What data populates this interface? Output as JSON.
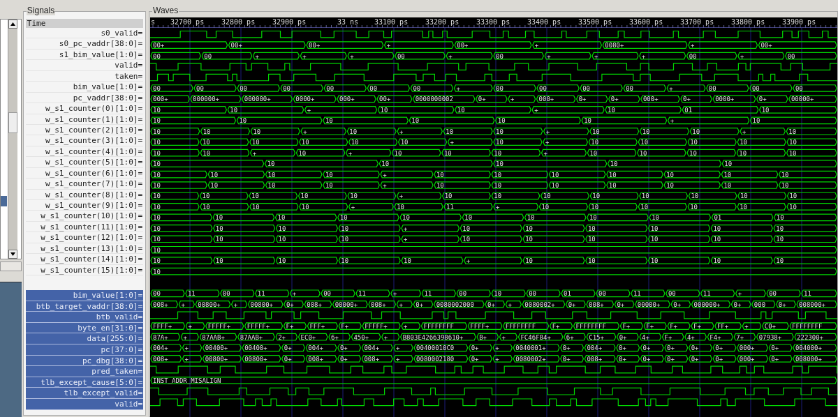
{
  "signals_panel": {
    "title": "Signals",
    "header": "Time"
  },
  "waves_panel": {
    "title": "Waves",
    "time_labels": [
      "s",
      "32700 ps",
      "32800 ps",
      "32900 ps",
      "33 ns",
      "33100 ps",
      "33200 ps",
      "33300 ps",
      "33400 ps",
      "33500 ps",
      "33600 ps",
      "33700 ps",
      "33800 ps",
      "33900 ps"
    ]
  },
  "signals": [
    {
      "name": "s0_valid=",
      "kind": "bit"
    },
    {
      "name": "s0_pc_vaddr[38:0]=",
      "kind": "bus",
      "values": [
        "00+",
        "00+",
        "00+",
        "+",
        "00+",
        "+",
        "0080+",
        "+",
        "00+"
      ]
    },
    {
      "name": "s1_bim_value[1:0]=",
      "kind": "bus",
      "values": [
        "00",
        "00",
        "+",
        "+",
        "+",
        "00",
        "+",
        "00",
        "+",
        "+",
        "+",
        "00",
        "+",
        "00"
      ]
    },
    {
      "name": "valid=",
      "kind": "bit"
    },
    {
      "name": "taken=",
      "kind": "bit"
    },
    {
      "name": "bim_value[1:0]=",
      "kind": "bus",
      "values": [
        "00",
        "00",
        "00",
        "00",
        "00",
        "00",
        "00",
        "+",
        "00",
        "00",
        "00",
        "00",
        "+",
        "00",
        "00",
        "00"
      ]
    },
    {
      "name": "pc_vaddr[38:0]=",
      "kind": "bus",
      "values": [
        "000+",
        "000000+",
        "000000+",
        "0000+",
        "000+",
        "00+",
        "0000000002",
        "0+",
        "+",
        "000+",
        "0+",
        "0+",
        "000+",
        "0+",
        "0000+",
        "0+",
        "00000+"
      ]
    },
    {
      "name": "w_s1_counter(0)[1:0]=",
      "kind": "bus",
      "values": [
        "10",
        "10",
        "+",
        "10",
        "10",
        "+",
        "10",
        "01",
        "10"
      ]
    },
    {
      "name": "w_s1_counter(1)[1:0]=",
      "kind": "bus",
      "values": [
        "10",
        "10",
        "10",
        "10",
        "10",
        "10",
        "+",
        "10"
      ]
    },
    {
      "name": "w_s1_counter(2)[1:0]=",
      "kind": "bus",
      "values": [
        "10",
        "10",
        "10",
        "+",
        "10",
        "+",
        "10",
        "10",
        "+",
        "10",
        "10",
        "10",
        "+",
        "10"
      ]
    },
    {
      "name": "w_s1_counter(3)[1:0]=",
      "kind": "bus",
      "values": [
        "10",
        "10",
        "10",
        "10",
        "10",
        "10",
        "+",
        "10",
        "+",
        "10",
        "10",
        "10",
        "10",
        "10"
      ]
    },
    {
      "name": "w_s1_counter(4)[1:0]=",
      "kind": "bus",
      "values": [
        "10",
        "10",
        "+",
        "10",
        "+",
        "10",
        "10",
        "10",
        "+",
        "10",
        "10",
        "10",
        "10",
        "10"
      ]
    },
    {
      "name": "w_s1_counter(5)[1:0]=",
      "kind": "bus",
      "values": [
        "10",
        "10",
        "10",
        "10",
        "10",
        "10"
      ]
    },
    {
      "name": "w_s1_counter(6)[1:0]=",
      "kind": "bus",
      "values": [
        "10",
        "10",
        "10",
        "10",
        "+",
        "10",
        "10",
        "10",
        "10",
        "10",
        "10",
        "10"
      ]
    },
    {
      "name": "w_s1_counter(7)[1:0]=",
      "kind": "bus",
      "values": [
        "10",
        "10",
        "10",
        "10",
        "+",
        "10",
        "10",
        "10",
        "10",
        "10",
        "10",
        "10"
      ]
    },
    {
      "name": "w_s1_counter(8)[1:0]=",
      "kind": "bus",
      "values": [
        "10",
        "10",
        "10",
        "10",
        "10",
        "+",
        "10",
        "10",
        "10",
        "10",
        "10",
        "10",
        "10",
        "10"
      ]
    },
    {
      "name": "w_s1_counter(9)[1:0]=",
      "kind": "bus",
      "values": [
        "10",
        "10",
        "10",
        "10",
        "+",
        "10",
        "11",
        "+",
        "10",
        "10",
        "10",
        "10",
        "10",
        "10"
      ]
    },
    {
      "name": "w_s1_counter(10)[1:0]=",
      "kind": "bus",
      "values": [
        "10",
        "10",
        "10",
        "10",
        "10",
        "10",
        "10",
        "10",
        "10",
        "01",
        "10"
      ]
    },
    {
      "name": "w_s1_counter(11)[1:0]=",
      "kind": "bus",
      "values": [
        "10",
        "10",
        "10",
        "10",
        "+",
        "10",
        "10",
        "10",
        "10",
        "10",
        "10"
      ]
    },
    {
      "name": "w_s1_counter(12)[1:0]=",
      "kind": "bus",
      "values": [
        "10",
        "10",
        "10",
        "10",
        "+",
        "10",
        "10",
        "10",
        "10",
        "10",
        "10"
      ]
    },
    {
      "name": "w_s1_counter(13)[1:0]=",
      "kind": "bus",
      "values": [
        "10"
      ]
    },
    {
      "name": "w_s1_counter(14)[1:0]=",
      "kind": "bus",
      "values": [
        "10",
        "10",
        "10",
        "10",
        "10",
        "+",
        "10",
        "10",
        "10",
        "10",
        "10"
      ]
    },
    {
      "name": "w_s1_counter(15)[1:0]=",
      "kind": "bus",
      "values": [
        "10"
      ]
    }
  ],
  "selected_signals": [
    {
      "name": "bim_value[1:0]=",
      "kind": "bus",
      "values": [
        "00",
        "11",
        "00",
        "11",
        "+",
        "00",
        "11",
        "+",
        "11",
        "00",
        "10",
        "00",
        "01",
        "00",
        "11",
        "00",
        "11",
        "+",
        "00",
        "11"
      ]
    },
    {
      "name": "btb_target_vaddr[38:0]=",
      "kind": "bus",
      "values": [
        "008+",
        "+",
        "00800+",
        "+",
        "00800+",
        "0+",
        "008+",
        "00000+",
        "008+",
        "+",
        "0+",
        "0080002000",
        "0+",
        "+",
        "0080002+",
        "0+",
        "008+",
        "0+",
        "00000+",
        "0+",
        "000000+",
        "0+",
        "000",
        "0+",
        "008000+"
      ]
    },
    {
      "name": "btb_valid=",
      "kind": "bit"
    },
    {
      "name": "byte_en[31:0]=",
      "kind": "bus",
      "values": [
        "FFFF+",
        "+",
        "FFFFF+",
        "FFFFF+",
        "F+",
        "FFF+",
        "F+",
        "FFFFF+",
        "+",
        "FFFFFFFF",
        "FFFF+",
        "FFFFFFFF",
        "F+",
        "FFFFFFFF",
        "F+",
        "F+",
        "F+",
        "F+",
        "FF+",
        "+",
        "C0+",
        "FFFFFFFF"
      ]
    },
    {
      "name": "data[255:0]=",
      "kind": "bus",
      "values": [
        "87A+",
        "+",
        "87AAB+",
        "87AAB+",
        "2+",
        "EC0+",
        "6+",
        "450+",
        "+",
        "B803E4266398610+",
        "B+",
        "+",
        "FC46F84+",
        "6+",
        "C15+",
        "0+",
        "4+",
        "F+",
        "4+",
        "F4+",
        "7+",
        "07938+",
        "222300+"
      ]
    },
    {
      "name": "pc[37:0]=",
      "kind": "bus",
      "values": [
        "004+",
        "+",
        "00400+",
        "00400+",
        "0+",
        "004+",
        "0+",
        "004+",
        "+",
        "00400010C0",
        "0+",
        "+",
        "0040001+",
        "0+",
        "004+",
        "0+",
        "0+",
        "0+",
        "0+",
        "0+",
        "000+",
        "0+",
        "004000+"
      ]
    },
    {
      "name": "pc_dbg[38:0]=",
      "kind": "bus",
      "values": [
        "008+",
        "+",
        "00800+",
        "00800+",
        "0+",
        "008+",
        "0+",
        "008+",
        "+",
        "0080002180",
        "0+",
        "+",
        "0080002+",
        "0+",
        "008+",
        "0+",
        "0+",
        "0+",
        "0+",
        "0+",
        "000+",
        "0+",
        "008000+"
      ]
    },
    {
      "name": "pred_taken=",
      "kind": "bit"
    },
    {
      "name": "tlb_except_cause[5:0]=",
      "kind": "bus",
      "values": [
        "INST_ADDR_MISALIGN"
      ]
    },
    {
      "name": "tlb_except_valid=",
      "kind": "bit"
    },
    {
      "name": "valid=",
      "kind": "bit"
    }
  ]
}
